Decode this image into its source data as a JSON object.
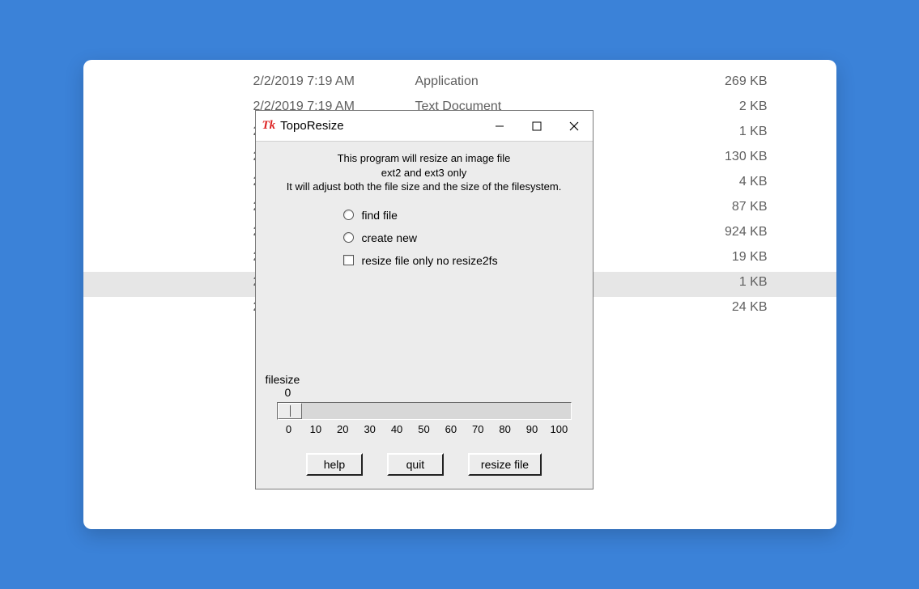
{
  "files": [
    {
      "date": "2/2/2019 7:19 AM",
      "type": "Application",
      "size": "269 KB",
      "selected": false
    },
    {
      "date": "2/2/2019 7:19 AM",
      "type": "Text Document",
      "size": "2 KB",
      "selected": false
    },
    {
      "date": "2",
      "type": "",
      "size": "1 KB",
      "selected": false
    },
    {
      "date": "2",
      "type": "",
      "size": "130 KB",
      "selected": false
    },
    {
      "date": "2",
      "type": "",
      "size": "4 KB",
      "selected": false
    },
    {
      "date": "2",
      "type": "",
      "size": "87 KB",
      "selected": false
    },
    {
      "date": "2",
      "type": "",
      "size": "924 KB",
      "selected": false
    },
    {
      "date": "2",
      "type": "",
      "size": "19 KB",
      "selected": false
    },
    {
      "date": "2",
      "type": "",
      "size": "1 KB",
      "selected": true
    },
    {
      "date": "2",
      "type": "",
      "size": "24 KB",
      "selected": false
    }
  ],
  "dialog": {
    "title": "TopoResize",
    "intro_line1": "This program will resize an  image file",
    "intro_line2": "ext2 and ext3 only",
    "intro_line3": "It will adjust both the file size and the size of the filesystem.",
    "option_find": "find file",
    "option_create": "create new",
    "option_resize_only": "resize file only no resize2fs",
    "slider_label": "filesize",
    "slider_value": "0",
    "slider_ticks": [
      "0",
      "10",
      "20",
      "30",
      "40",
      "50",
      "60",
      "70",
      "80",
      "90",
      "100"
    ],
    "btn_help": "help",
    "btn_quit": "quit",
    "btn_resize": "resize file"
  }
}
